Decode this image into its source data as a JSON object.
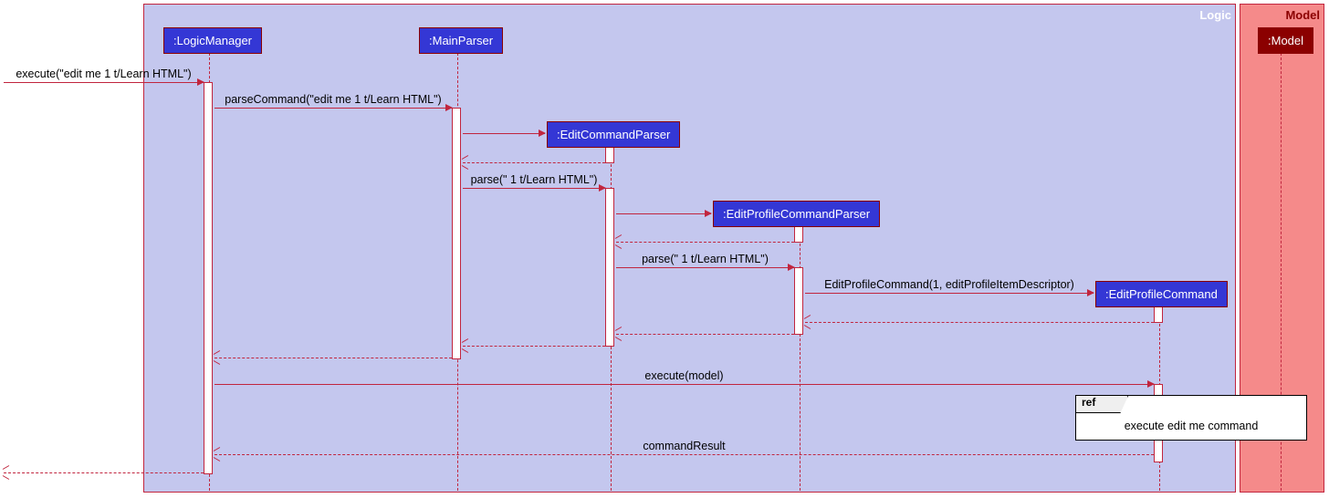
{
  "frames": {
    "logic": "Logic",
    "model": "Model"
  },
  "participants": {
    "logicManager": ":LogicManager",
    "mainParser": ":MainParser",
    "editCommandParser": ":EditCommandParser",
    "editProfileCommandParser": ":EditProfileCommandParser",
    "editProfileCommand": ":EditProfileCommand",
    "model": ":Model"
  },
  "messages": {
    "execute": "execute(\"edit me 1 t/Learn HTML\")",
    "parseCommand": "parseCommand(\"edit me 1 t/Learn HTML\")",
    "parse1": "parse(\" 1 t/Learn HTML\")",
    "parse2": "parse(\" 1 t/Learn HTML\")",
    "editProfileCmd": "EditProfileCommand(1, editProfileItemDescriptor)",
    "executeModel": "execute(model)",
    "commandResult": "commandResult"
  },
  "ref": {
    "label": "ref",
    "text": "execute edit me command"
  },
  "chart_data": {
    "type": "sequence_diagram",
    "frames": [
      {
        "name": "Logic",
        "contains": [
          ":LogicManager",
          ":MainParser",
          ":EditCommandParser",
          ":EditProfileCommandParser",
          ":EditProfileCommand"
        ]
      },
      {
        "name": "Model",
        "contains": [
          ":Model"
        ]
      }
    ],
    "participants": [
      {
        "name": ":LogicManager",
        "created_at_start": true
      },
      {
        "name": ":MainParser",
        "created_at_start": true
      },
      {
        "name": ":EditCommandParser",
        "created_at_start": false
      },
      {
        "name": ":EditProfileCommandParser",
        "created_at_start": false
      },
      {
        "name": ":EditProfileCommand",
        "created_at_start": false
      },
      {
        "name": ":Model",
        "created_at_start": true
      }
    ],
    "messages": [
      {
        "from": "external",
        "to": ":LogicManager",
        "label": "execute(\"edit me 1 t/Learn HTML\")",
        "type": "sync"
      },
      {
        "from": ":LogicManager",
        "to": ":MainParser",
        "label": "parseCommand(\"edit me 1 t/Learn HTML\")",
        "type": "sync"
      },
      {
        "from": ":MainParser",
        "to": ":EditCommandParser",
        "label": "",
        "type": "create"
      },
      {
        "from": ":EditCommandParser",
        "to": ":MainParser",
        "label": "",
        "type": "return"
      },
      {
        "from": ":MainParser",
        "to": ":EditCommandParser",
        "label": "parse(\" 1 t/Learn HTML\")",
        "type": "sync"
      },
      {
        "from": ":EditCommandParser",
        "to": ":EditProfileCommandParser",
        "label": "",
        "type": "create"
      },
      {
        "from": ":EditProfileCommandParser",
        "to": ":EditCommandParser",
        "label": "",
        "type": "return"
      },
      {
        "from": ":EditCommandParser",
        "to": ":EditProfileCommandParser",
        "label": "parse(\" 1 t/Learn HTML\")",
        "type": "sync"
      },
      {
        "from": ":EditProfileCommandParser",
        "to": ":EditProfileCommand",
        "label": "EditProfileCommand(1, editProfileItemDescriptor)",
        "type": "create"
      },
      {
        "from": ":EditProfileCommand",
        "to": ":EditProfileCommandParser",
        "label": "",
        "type": "return"
      },
      {
        "from": ":EditProfileCommandParser",
        "to": ":EditCommandParser",
        "label": "",
        "type": "return"
      },
      {
        "from": ":EditCommandParser",
        "to": ":MainParser",
        "label": "",
        "type": "return"
      },
      {
        "from": ":MainParser",
        "to": ":LogicManager",
        "label": "",
        "type": "return"
      },
      {
        "from": ":LogicManager",
        "to": ":EditProfileCommand",
        "label": "execute(model)",
        "type": "sync"
      },
      {
        "ref": "execute edit me command",
        "over": [
          ":EditProfileCommand",
          ":Model"
        ]
      },
      {
        "from": ":EditProfileCommand",
        "to": ":LogicManager",
        "label": "commandResult",
        "type": "return"
      },
      {
        "from": ":LogicManager",
        "to": "external",
        "label": "",
        "type": "return"
      }
    ]
  }
}
